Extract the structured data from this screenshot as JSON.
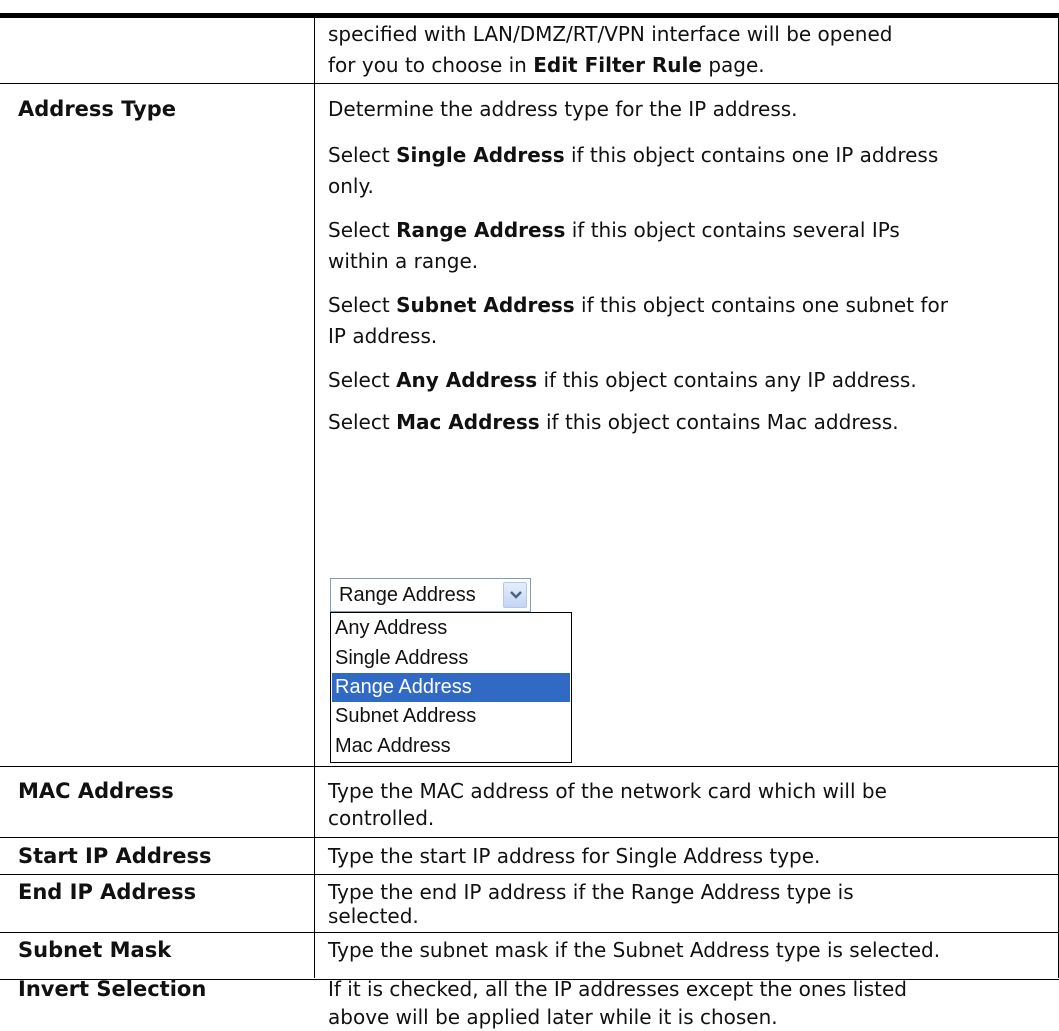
{
  "top_row": {
    "line1": "specified with LAN/DMZ/RT/VPN interface will be opened",
    "line2_prefix": "for you to choose in ",
    "line2_bold": "Edit Filter Rule",
    "line2_suffix": " page."
  },
  "address_type": {
    "label": "Address Type",
    "intro": "Determine the address type for the IP address.",
    "items": [
      {
        "pre": "Select ",
        "bold": "Single Address",
        "post": " if this object contains one IP address",
        "line2": "only."
      },
      {
        "pre": "Select ",
        "bold": "Range Address",
        "post": " if this object contains several IPs",
        "line2": "within a range."
      },
      {
        "pre": "Select ",
        "bold": "Subnet Address",
        "post": " if this object contains one subnet for",
        "line2": "IP address."
      },
      {
        "pre": "Select ",
        "bold": "Any Address",
        "post": " if this object contains any IP address.",
        "line2": ""
      },
      {
        "pre": "Select ",
        "bold": "Mac Address",
        "post": " if this object contains Mac address.",
        "line2": ""
      }
    ],
    "select": {
      "value": "Range Address",
      "options": [
        "Any Address",
        "Single Address",
        "Range Address",
        "Subnet Address",
        "Mac Address"
      ],
      "highlight_color": "#316ac5"
    }
  },
  "rows": [
    {
      "label": "MAC Address",
      "line1": "Type the MAC address of the network card which will be",
      "line2": "controlled."
    },
    {
      "label": "Start IP Address",
      "line1": "Type the start IP address for Single Address type.",
      "line2": ""
    },
    {
      "label": "End IP Address",
      "line1": "Type the end IP address if the Range Address type is",
      "line2": "selected."
    },
    {
      "label": "Subnet Mask",
      "line1": "Type the subnet mask if the Subnet Address type is selected.",
      "line2": ""
    },
    {
      "label": "Invert Selection",
      "line1": "If it is checked, all the IP addresses except the ones listed",
      "line2": "above will be applied later while it is chosen."
    }
  ]
}
